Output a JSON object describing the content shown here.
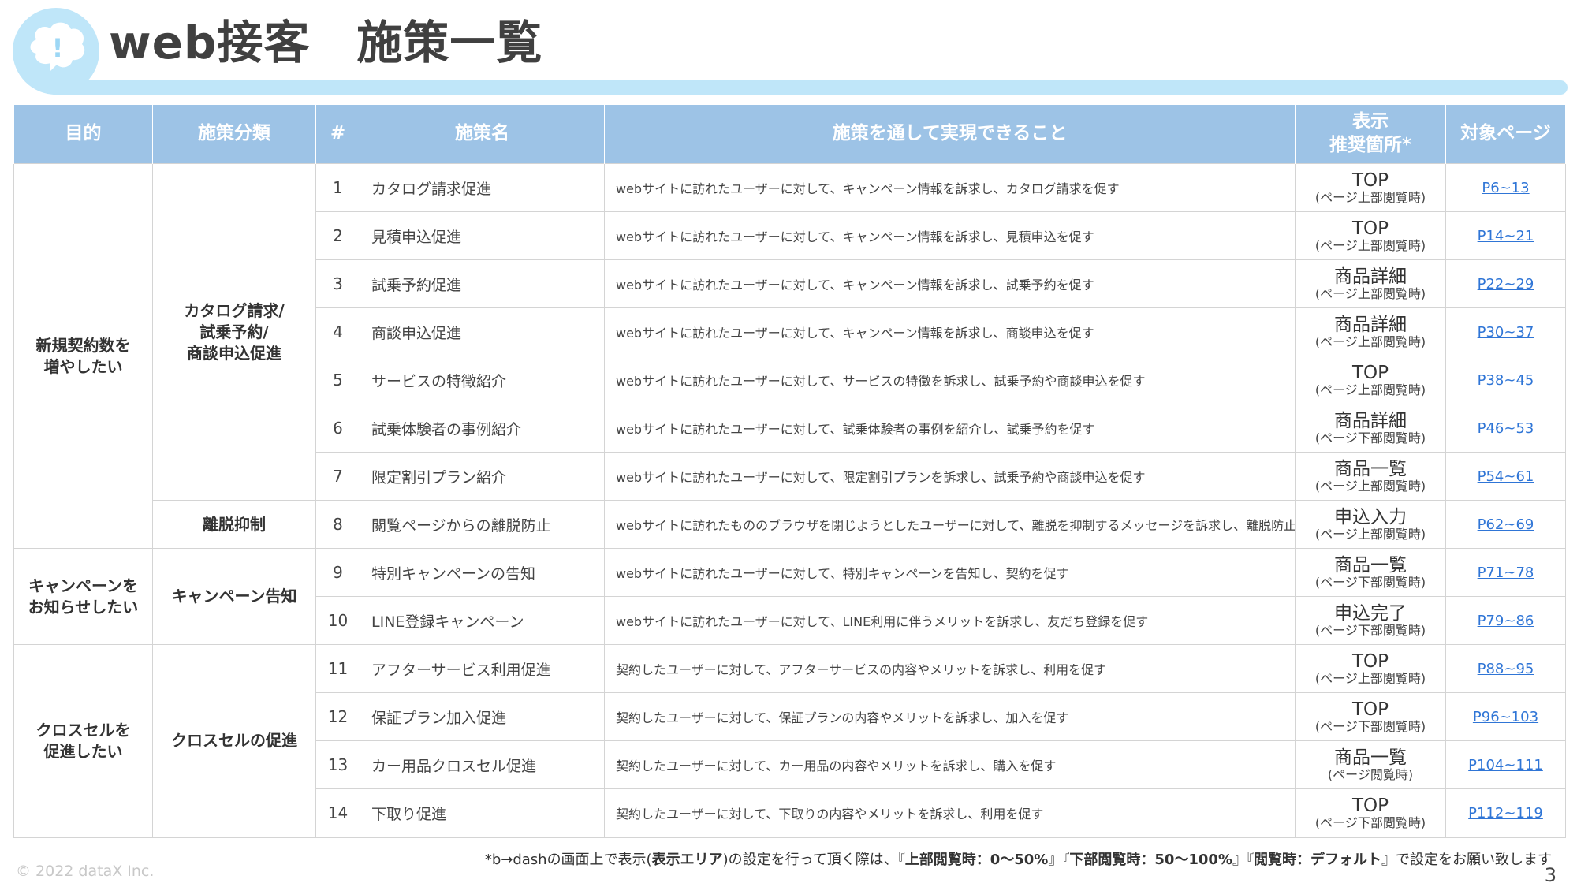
{
  "header": {
    "title": "web接客　施策一覧",
    "accent_color": "#bfe6f9"
  },
  "table": {
    "header_color": "#9dc3e6",
    "columns": {
      "purpose": "目的",
      "category": "施策分類",
      "num": "#",
      "name": "施策名",
      "desc": "施策を通して実現できること",
      "display_line1": "表示",
      "display_line2": "推奨箇所*",
      "page": "対象ページ"
    },
    "purposes": [
      "新規契約数を\n増やしたい",
      "キャンペーンを\nお知らせしたい",
      "クロスセルを\n促進したい"
    ],
    "categories": [
      "カタログ請求/\n試乗予約/\n商談申込促進",
      "離脱抑制",
      "キャンペーン告知",
      "クロスセルの促進"
    ],
    "rows": [
      {
        "num": "1",
        "name": "カタログ請求促進",
        "desc": "webサイトに訪れたユーザーに対して、キャンペーン情報を訴求し、カタログ請求を促す",
        "display": "TOP",
        "display_sub": "(ページ上部閲覧時)",
        "page": "P6~13"
      },
      {
        "num": "2",
        "name": "見積申込促進",
        "desc": "webサイトに訪れたユーザーに対して、キャンペーン情報を訴求し、見積申込を促す",
        "display": "TOP",
        "display_sub": "(ページ上部閲覧時)",
        "page": "P14~21"
      },
      {
        "num": "3",
        "name": "試乗予約促進",
        "desc": "webサイトに訪れたユーザーに対して、キャンペーン情報を訴求し、試乗予約を促す",
        "display": "商品詳細",
        "display_sub": "(ページ上部閲覧時)",
        "page": "P22~29"
      },
      {
        "num": "4",
        "name": "商談申込促進",
        "desc": "webサイトに訪れたユーザーに対して、キャンペーン情報を訴求し、商談申込を促す",
        "display": "商品詳細",
        "display_sub": "(ページ上部閲覧時)",
        "page": "P30~37"
      },
      {
        "num": "5",
        "name": "サービスの特徴紹介",
        "desc": "webサイトに訪れたユーザーに対して、サービスの特徴を訴求し、試乗予約や商談申込を促す",
        "display": "TOP",
        "display_sub": "(ページ上部閲覧時)",
        "page": "P38~45"
      },
      {
        "num": "6",
        "name": "試乗体験者の事例紹介",
        "desc": "webサイトに訪れたユーザーに対して、試乗体験者の事例を紹介し、試乗予約を促す",
        "display": "商品詳細",
        "display_sub": "(ページ下部閲覧時)",
        "page": "P46~53"
      },
      {
        "num": "7",
        "name": "限定割引プラン紹介",
        "desc": "webサイトに訪れたユーザーに対して、限定割引プランを訴求し、試乗予約や商談申込を促す",
        "display": "商品一覧",
        "display_sub": "(ページ上部閲覧時)",
        "page": "P54~61"
      },
      {
        "num": "8",
        "name": "閲覧ページからの離脱防止",
        "desc": "webサイトに訪れたもののブラウザを閉じようとしたユーザーに対して、離脱を抑制するメッセージを訴求し、離脱防止を促す",
        "display": "申込入力",
        "display_sub": "(ページ上部閲覧時)",
        "page": "P62~69"
      },
      {
        "num": "9",
        "name": "特別キャンペーンの告知",
        "desc": "webサイトに訪れたユーザーに対して、特別キャンペーンを告知し、契約を促す",
        "display": "商品一覧",
        "display_sub": "(ページ下部閲覧時)",
        "page": "P71~78"
      },
      {
        "num": "10",
        "name": "LINE登録キャンペーン",
        "desc": "webサイトに訪れたユーザーに対して、LINE利用に伴うメリットを訴求し、友だち登録を促す",
        "display": "申込完了",
        "display_sub": "(ページ下部閲覧時)",
        "page": "P79~86"
      },
      {
        "num": "11",
        "name": "アフターサービス利用促進",
        "desc": "契約したユーザーに対して、アフターサービスの内容やメリットを訴求し、利用を促す",
        "display": "TOP",
        "display_sub": "(ページ上部閲覧時)",
        "page": "P88~95"
      },
      {
        "num": "12",
        "name": "保証プラン加入促進",
        "desc": "契約したユーザーに対して、保証プランの内容やメリットを訴求し、加入を促す",
        "display": "TOP",
        "display_sub": "(ページ下部閲覧時)",
        "page": "P96~103"
      },
      {
        "num": "13",
        "name": "カー用品クロスセル促進",
        "desc": "契約したユーザーに対して、カー用品の内容やメリットを訴求し、購入を促す",
        "display": "商品一覧",
        "display_sub": "(ページ閲覧時)",
        "page": "P104~111"
      },
      {
        "num": "14",
        "name": "下取り促進",
        "desc": "契約したユーザーに対して、下取りの内容やメリットを訴求し、利用を促す",
        "display": "TOP",
        "display_sub": "(ページ下部閲覧時)",
        "page": "P112~119"
      }
    ]
  },
  "footnote": {
    "p1": "*b→dashの画面上で表示(",
    "b1": "表示エリア",
    "p2": ")の設定を行って頂く際は、『",
    "b2": "上部閲覧時：0〜50%",
    "p3": "』『",
    "b3": "下部閲覧時：50〜100%",
    "p4": "』『",
    "b4": "閲覧時：デフォルト",
    "p5": "』で設定をお願い致します"
  },
  "copyright": "© 2022 dataX Inc.",
  "page_number": "3",
  "link_color": "#2f75d6"
}
